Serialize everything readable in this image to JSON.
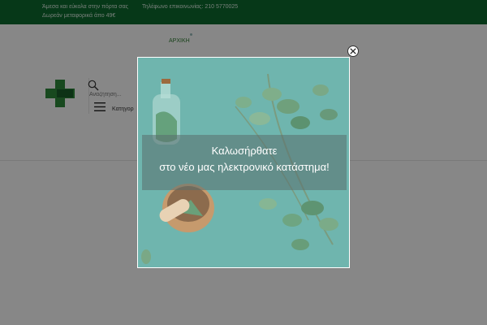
{
  "topbar": {
    "delivery_text": "Άμεσα και εύκολα στην πόρτα σας",
    "shipping_text": "Δωρεάν μεταφορικά άπο 49€",
    "phone_text": "Τηλέφωνο επικοινωνίας: 210 5770025"
  },
  "nav": {
    "home_label": "ΑΡΧΙΚΗ"
  },
  "search": {
    "placeholder": "Αναζήτηση..."
  },
  "menu": {
    "categories_label": "Κατηγορ"
  },
  "popup": {
    "line1": "Καλωσήρθατε",
    "line2": "στο νέο μας ηλεκτρονικό κατάστημα!",
    "close_icon": "close-icon"
  },
  "colors": {
    "brand_green": "#0d6b2f",
    "overlay": "rgba(0,0,0,0.47)",
    "image_bg": "#6fb5ae"
  }
}
